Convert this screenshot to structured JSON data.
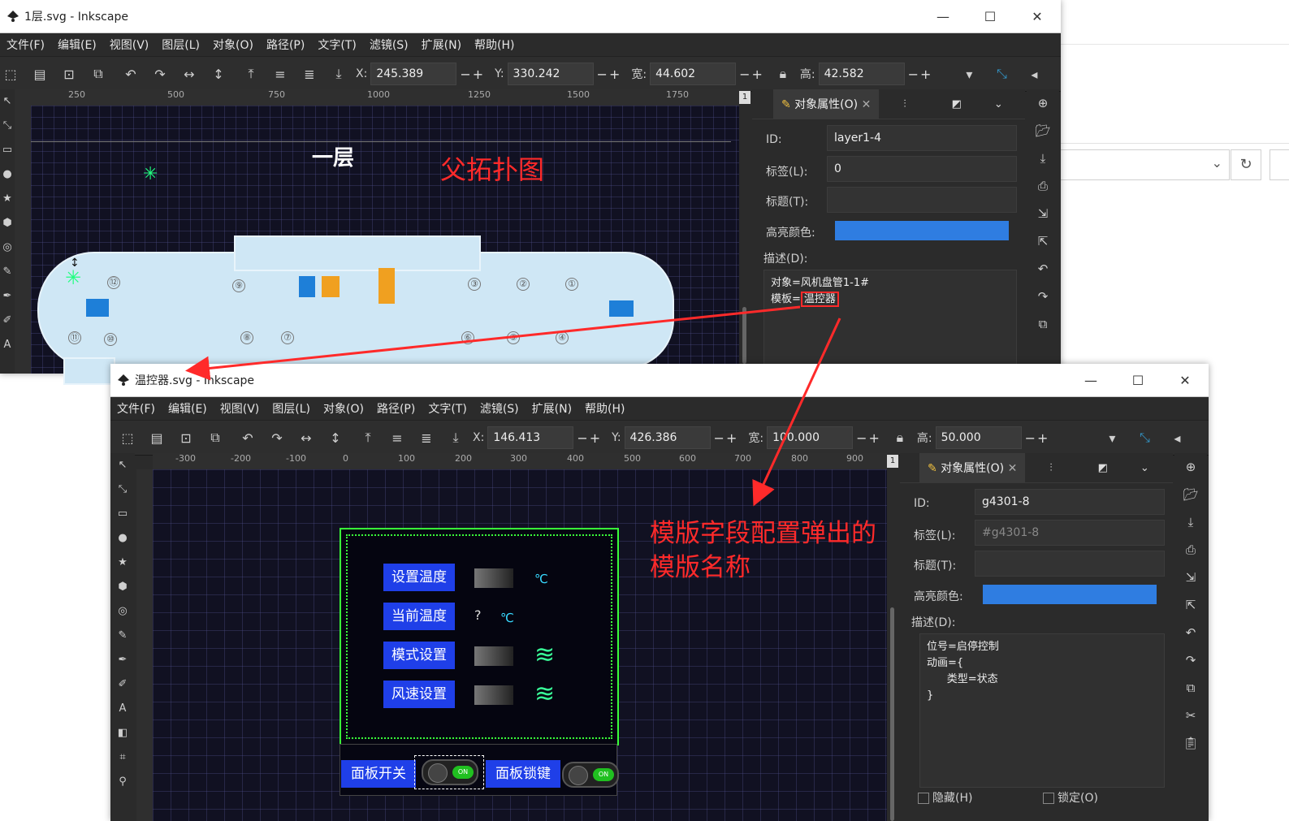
{
  "background_window": {},
  "window1": {
    "title": "1层.svg - Inkscape",
    "menu": [
      "文件(F)",
      "编辑(E)",
      "视图(V)",
      "图层(L)",
      "对象(O)",
      "路径(P)",
      "文字(T)",
      "滤镜(S)",
      "扩展(N)",
      "帮助(H)"
    ],
    "coords": {
      "x_label": "X:",
      "x": "245.389",
      "y_label": "Y:",
      "y": "330.242",
      "w_label": "宽:",
      "w": "44.602",
      "h_label": "高:",
      "h": "42.582"
    },
    "ruler_ticks": [
      "250",
      "500",
      "750",
      "1000",
      "1250",
      "1500",
      "1750"
    ],
    "ruler_badge": "1",
    "canvas": {
      "floor_title": "一层",
      "map_title": "父拓扑图",
      "rooms": [
        "⑫",
        "⑨",
        "③",
        "②",
        "①",
        "⑪",
        "⑩",
        "⑧",
        "⑦",
        "⑥",
        "⑤",
        "④"
      ]
    },
    "panel": {
      "tab_label": "对象属性(O)",
      "id_label": "ID:",
      "id_value": "layer1-4",
      "label_label": "标签(L):",
      "label_value": "0",
      "title_label": "标题(T):",
      "title_value": "",
      "highlight_label": "高亮颜色:",
      "highlight_color": "#2f7de1",
      "desc_label": "描述(D):",
      "desc_line1": "对象=风机盘管1-1#",
      "desc_line2_prefix": "模板=",
      "desc_line2_value": "温控器"
    }
  },
  "window2": {
    "title": "温控器.svg - Inkscape",
    "menu": [
      "文件(F)",
      "编辑(E)",
      "视图(V)",
      "图层(L)",
      "对象(O)",
      "路径(P)",
      "文字(T)",
      "滤镜(S)",
      "扩展(N)",
      "帮助(H)"
    ],
    "coords": {
      "x_label": "X:",
      "x": "146.413",
      "y_label": "Y:",
      "y": "426.386",
      "w_label": "宽:",
      "w": "100.000",
      "h_label": "高:",
      "h": "50.000"
    },
    "ruler_ticks": [
      "-300",
      "-200",
      "-100",
      "0",
      "100",
      "200",
      "300",
      "400",
      "500",
      "600",
      "700",
      "800",
      "900"
    ],
    "ruler_badge": "1",
    "thermostat": {
      "rows": [
        {
          "button": "设置温度",
          "value": "",
          "unit": "℃"
        },
        {
          "button": "当前温度",
          "value": "?",
          "unit": "℃"
        },
        {
          "button": "模式设置",
          "value": "",
          "unit": ""
        },
        {
          "button": "风速设置",
          "value": "",
          "unit": ""
        }
      ],
      "panel_switch": "面板开关",
      "panel_lock": "面板锁键",
      "toggle_text": "ON"
    },
    "annotation": "模版字段配置弹出的\n模版名称",
    "panel": {
      "tab_label": "对象属性(O)",
      "id_label": "ID:",
      "id_value": "g4301-8",
      "label_label": "标签(L):",
      "label_value": "#g4301-8",
      "title_label": "标题(T):",
      "title_value": "",
      "highlight_label": "高亮颜色:",
      "highlight_color": "#2f7de1",
      "desc_label": "描述(D):",
      "desc_text": "位号=启停控制\n动画={\n      类型=状态\n}",
      "hidden_label": "隐藏(H)",
      "lock_label": "锁定(O)"
    }
  },
  "annotation_color": "#ff2a2a"
}
